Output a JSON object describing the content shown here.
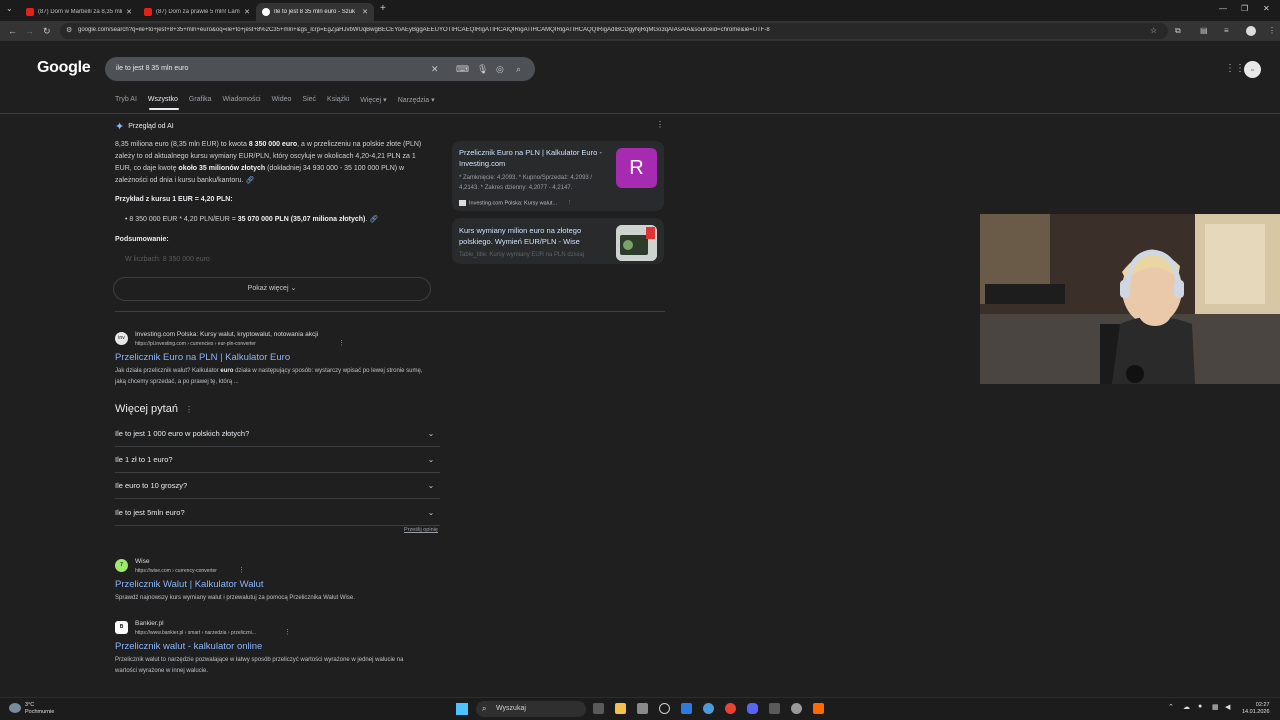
{
  "browser": {
    "tabs": [
      {
        "title": "(87) Dom w Marbelli za 8,35 mln",
        "active": false
      },
      {
        "title": "(87) Dom za prawie 5 mln! Lam",
        "active": false
      },
      {
        "title": "Ile to jest 8 35 mln euro - Szuk",
        "active": true
      }
    ],
    "url": "google.com/search?q=ile+to+jest+8+35+mln+euro&oq=ile+to+jest+8%2C35+mln+&gs_lcrp=EgZjaHJvbWUqBwgBECEYoAEyBggAEEUYOTIHCAEQIRigATIHCAIQIRigATIHCAMQIRigATIHCAQQIRigAdIBCDgyNjRqMGo3qAIAsAIA&sourceid=chrome&ie=UTF-8"
  },
  "google": {
    "logo": "Google",
    "query": "ile to jest 8 35 mln euro",
    "filters": [
      "Tryb AI",
      "Wszystko",
      "Grafika",
      "Wiadomości",
      "Wideo",
      "Sieć",
      "Książki",
      "Więcej ▾",
      "Narzędzia ▾"
    ],
    "active_filter_index": 1
  },
  "ai_overview": {
    "heading": "Przegląd od AI",
    "para_1": "8,35 miliona euro (8,35 mln EUR) to kwota ",
    "para_1_bold": "8 350 000 euro",
    "para_2": ", a w przeliczeniu na polskie złote (PLN) zależy to od aktualnego kursu wymiany EUR/PLN, który oscyluje w okolicach 4,20-4,21 PLN za 1 EUR, co daje kwotę ",
    "para_2_bold": "około 35 milionów złotych",
    "para_3": " (dokładniej 34 930 000 - 35 100 000 PLN) w zależności od dnia i kursu banku/kantoru.",
    "example_heading": "Przykład z kursu 1 EUR = 4,20 PLN:",
    "bullet_text": "8 350 000 EUR * 4,20 PLN/EUR = ",
    "bullet_bold": "35 070 000 PLN (35,07 miliona złotych)",
    "summary_heading": "Podsumowanie:",
    "faded_text": "W liczbach: 8 350 000 euro",
    "show_more": "Pokaż więcej ⌄"
  },
  "source_cards": [
    {
      "title": "Przelicznik Euro na PLN | Kalkulator Euro - Investing.com",
      "snippet": "* Zamknięcie: 4,2093. * Kupno/Sprzedaż: 4,2093 / 4,2143. * Zakres dzienny: 4,2077 - 4,2147.",
      "site": "Investing.com Polska: Kursy walut...",
      "thumb_letter": "R",
      "thumb_color": "#a62bb1"
    },
    {
      "title": "Kurs wymiany milion euro na złotego polskiego. Wymień EUR/PLN - Wise",
      "snippet": "Table_title: Kursy wymiany EUR na PLN dzisiaj"
    }
  ],
  "results": [
    {
      "site": "Investing.com Polska: Kursy walut, kryptowalut, notowania akcji",
      "url": "https://pl.investing.com › currencies › eur-pln-converter",
      "title": "Przelicznik Euro na PLN | Kalkulator Euro",
      "snippet_1": "Jak działa przelicznik walut? Kalkulator ",
      "snippet_bold": "euro",
      "snippet_2": " działa w następujący sposób: wystarczy wpisać po lewej stronie sumę, jaką chcemy sprzedać, a po prawej tę, którą ...",
      "favicon": "inv"
    },
    {
      "site": "Wise",
      "url": "https://wise.com › currency-converter",
      "title": "Przelicznik Walut | Kalkulator Walut",
      "snippet": "Sprawdź najnowszy kurs wymiany walut i przewalutuj za pomocą Przelicznika Walut Wise.",
      "favicon": "7"
    },
    {
      "site": "Bankier.pl",
      "url": "https://www.bankier.pl › smart › narzedzia › przeliczni...",
      "title": "Przelicznik walut - kalkulator online",
      "snippet": "Przelicznik walut to narzędzie pozwalające w łatwy sposób przeliczyć wartości wyrażone w jednej walucie na wartości wyrażone w innej walucie.",
      "favicon": "B"
    }
  ],
  "paa": {
    "title": "Więcej pytań",
    "questions": [
      "Ile to jest 1 000 euro w polskich złotych?",
      "Ile 1 zł to 1 euro?",
      "Ile euro to 10 groszy?",
      "Ile to jest 5mln euro?"
    ],
    "feedback": "Prześlij opinię"
  },
  "taskbar": {
    "weather_temp": "3°C",
    "weather_desc": "Pochmurnie",
    "search": "Wyszukaj",
    "time": "02:27",
    "date": "14.01.2026"
  }
}
